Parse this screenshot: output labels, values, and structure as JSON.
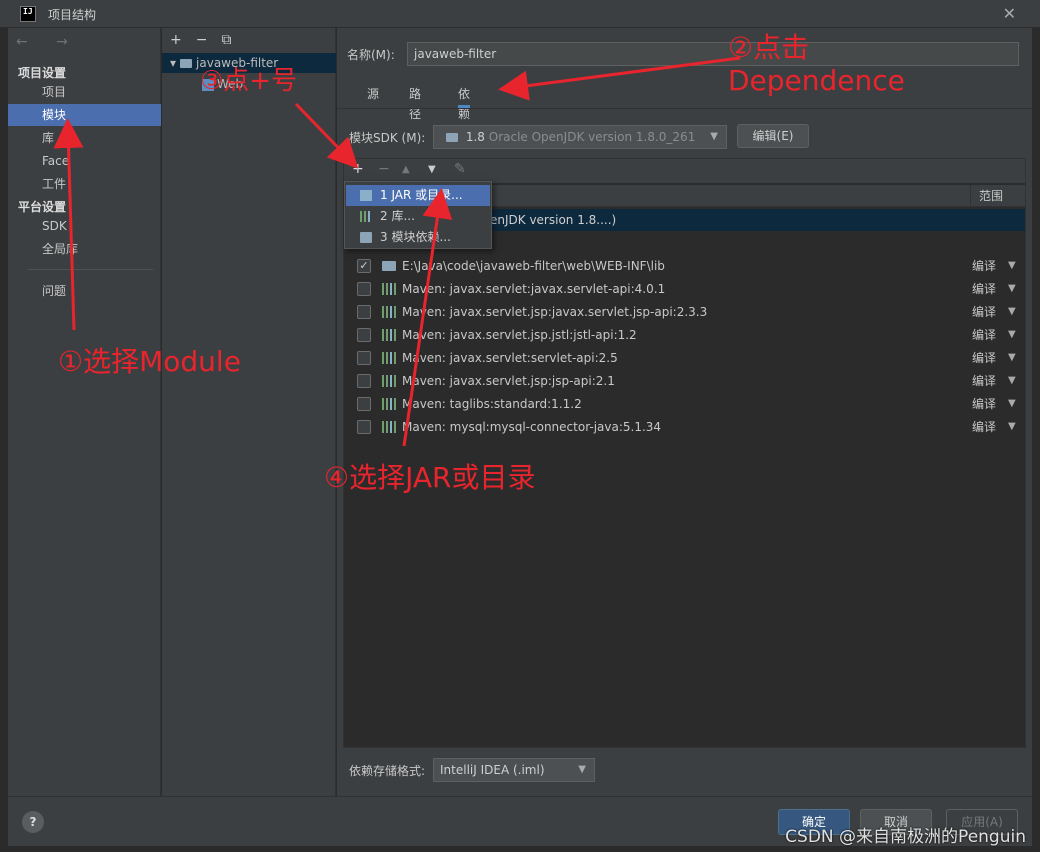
{
  "window": {
    "title": "项目结构",
    "close": "✕",
    "logo_text": "IJ"
  },
  "nav": {
    "arrows": "← →",
    "section1": "项目设置",
    "items1": [
      "项目",
      "模块",
      "库",
      "Face",
      "工件"
    ],
    "section2": "平台设置",
    "items2": [
      "SDK",
      "全局库"
    ],
    "problems": "问题"
  },
  "tree": {
    "toolbar": [
      "+",
      "−",
      "⧉"
    ],
    "root": "javaweb-filter",
    "child": "Web"
  },
  "main": {
    "name_label": "名称(M):",
    "name_value": "javaweb-filter",
    "tabs": [
      "源",
      "路径",
      "依赖"
    ],
    "sdk_label": "模块SDK (M):",
    "sdk_value": "1.8",
    "sdk_version": "Oracle OpenJDK version 1.8.0_261",
    "edit_button": "编辑(E)",
    "scope_header": "范围",
    "sdk_row": "enJDK version 1.8....)",
    "format_label": "依赖存储格式:",
    "format_value": "IntelliJ IDEA (.iml)"
  },
  "deps_toolbar": [
    "+",
    "−",
    "▲",
    "▼",
    "✎"
  ],
  "dependencies": [
    {
      "text": "E:\\Java\\code\\javaweb-filter\\web\\WEB-INF\\lib",
      "scope": "编译",
      "checked": true,
      "icon": "folder"
    },
    {
      "text": "Maven: javax.servlet:javax.servlet-api:4.0.1",
      "scope": "编译",
      "checked": false,
      "icon": "library"
    },
    {
      "text": "Maven: javax.servlet.jsp:javax.servlet.jsp-api:2.3.3",
      "scope": "编译",
      "checked": false,
      "icon": "library"
    },
    {
      "text": "Maven: javax.servlet.jsp.jstl:jstl-api:1.2",
      "scope": "编译",
      "checked": false,
      "icon": "library"
    },
    {
      "text": "Maven: javax.servlet:servlet-api:2.5",
      "scope": "编译",
      "checked": false,
      "icon": "library"
    },
    {
      "text": "Maven: javax.servlet.jsp:jsp-api:2.1",
      "scope": "编译",
      "checked": false,
      "icon": "library"
    },
    {
      "text": "Maven: taglibs:standard:1.1.2",
      "scope": "编译",
      "checked": false,
      "icon": "library"
    },
    {
      "text": "Maven: mysql:mysql-connector-java:5.1.34",
      "scope": "编译",
      "checked": false,
      "icon": "library"
    }
  ],
  "popup": [
    {
      "label": "1  JAR 或目录...",
      "icon": "jar-icon"
    },
    {
      "label": "2  库...",
      "icon": "library-icon"
    },
    {
      "label": "3  模块依赖...",
      "icon": "module-icon"
    }
  ],
  "buttons": {
    "help": "?",
    "ok": "确定",
    "cancel": "取消",
    "apply": "应用(A)"
  },
  "watermark": "CSDN @来自南极洲的Penguin",
  "annotations": {
    "a1": "①选择Module",
    "a2_line1": "②点击",
    "a2_line2": "Dependence",
    "a3": "③点+号",
    "a4": "④选择JAR或目录",
    "color": "#e8242d"
  }
}
